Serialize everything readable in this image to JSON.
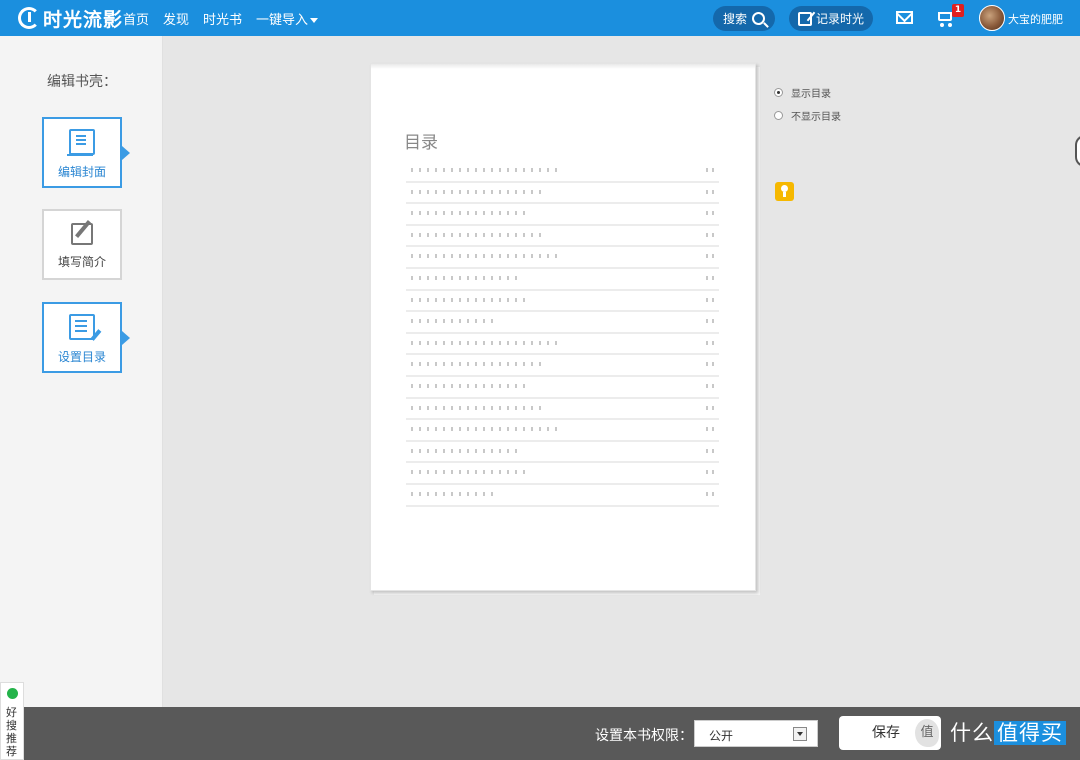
{
  "header": {
    "logo": "时光流影",
    "nav": [
      "首页",
      "发现",
      "时光书",
      "一键导入"
    ],
    "search_label": "搜索",
    "record_label": "记录时光",
    "cart_badge": "1",
    "username": "大宝的肥肥"
  },
  "sidebar": {
    "title": "编辑书壳：",
    "items": [
      {
        "label": "编辑封面",
        "icon": "book-cover-icon",
        "active": true
      },
      {
        "label": "填写简介",
        "icon": "edit-pencil-icon",
        "active": false
      },
      {
        "label": "设置目录",
        "icon": "list-edit-icon",
        "active": true
      }
    ]
  },
  "preview": {
    "toc_title": "目录",
    "row_count": 16
  },
  "options": {
    "show_toc": "显示目录",
    "hide_toc": "不显示目录",
    "selected": "显示目录"
  },
  "footer": {
    "permission_label": "设置本书权限：",
    "permission_value": "公开",
    "save_label": "保存",
    "save_extra": "值",
    "watermark_prefix": "什么",
    "watermark_highlight": "值得买"
  },
  "recommend_widget": {
    "text": "好搜推荐"
  },
  "colors": {
    "brand": "#1b8fde",
    "active_border": "#3b9be4",
    "footer": "#595959"
  }
}
